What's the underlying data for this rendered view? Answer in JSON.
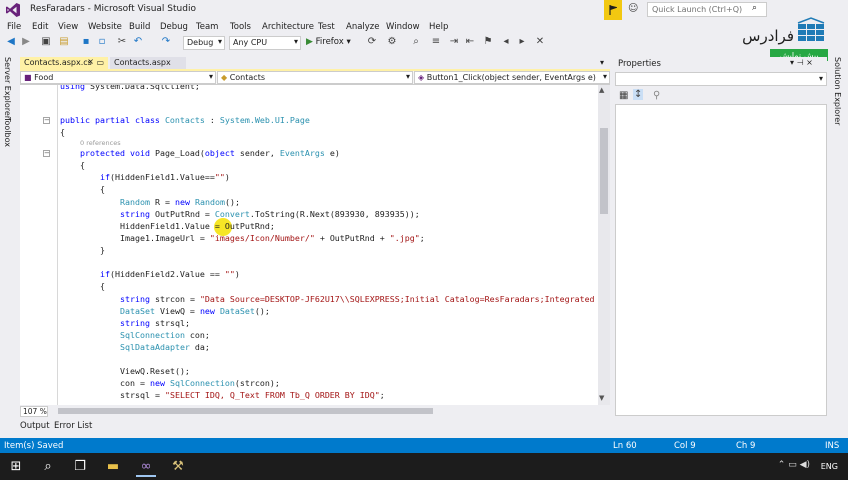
{
  "window": {
    "title": "ResFaradars - Microsoft Visual Studio",
    "quick_launch_placeholder": "Quick Launch (Ctrl+Q)"
  },
  "watermark": {
    "logo_text": "فرادرس",
    "badge": "پیش نمایش"
  },
  "menu": [
    "File",
    "Edit",
    "View",
    "Website",
    "Build",
    "Debug",
    "Team",
    "Tools",
    "Architecture",
    "Test",
    "Analyze",
    "Window",
    "Help"
  ],
  "toolbar": {
    "config": "Debug",
    "platform": "Any CPU",
    "run_label": "Firefox"
  },
  "side_tabs": {
    "left": [
      "Server Explorer",
      "Toolbox"
    ],
    "right": [
      "Solution Explorer"
    ]
  },
  "doc_tabs": [
    {
      "label": "Contacts.aspx.cs",
      "active": true
    },
    {
      "label": "Contacts.aspx",
      "active": false
    }
  ],
  "nav": {
    "project": "Food",
    "class": "Contacts",
    "member": "Button1_Click(object sender, EventArgs e)"
  },
  "editor": {
    "zoom": "107 %",
    "refs": "0 references"
  },
  "properties": {
    "title": "Properties"
  },
  "bottom_tabs": [
    "Output",
    "Error List"
  ],
  "status": {
    "message": "Item(s) Saved",
    "ln": "Ln 60",
    "col": "Col 9",
    "ch": "Ch 9",
    "mode": "INS"
  },
  "taskbar": {
    "lang": "ENG"
  }
}
